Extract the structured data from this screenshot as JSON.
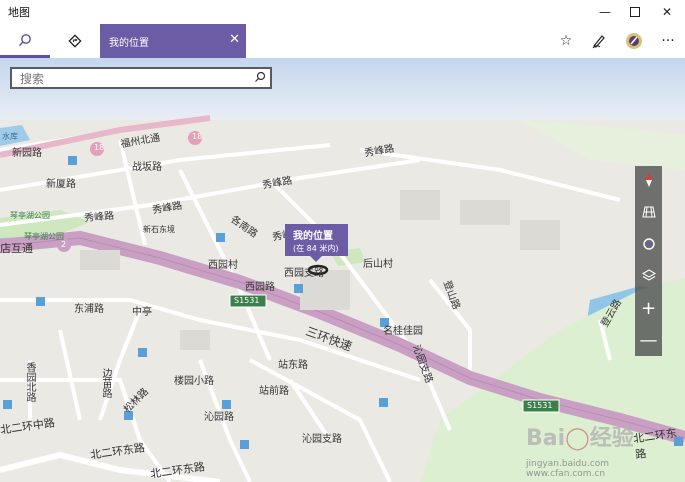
{
  "window": {
    "title": "地图"
  },
  "tabs": {
    "location_label": "我的位置"
  },
  "search": {
    "placeholder": "搜索"
  },
  "marker": {
    "title": "我的位置",
    "accuracy": "(在 84 米内)"
  },
  "map_labels": {
    "shuiku": "水库",
    "fuzhou_beitong": "福州北通",
    "r18a": "18",
    "r18b": "18",
    "xinyuan": "新园路",
    "zhanban": "战坂路",
    "xinxia": "新厦路",
    "xiufeng1": "秀峰路",
    "xiufeng2": "秀峰路",
    "xiufeng3": "秀峰路",
    "xiufeng4": "秀峰路",
    "xiufeng5": "秀峰路",
    "qintinghu": "琴亭湖公园",
    "qintinghu2": "琴亭湖公园",
    "xinshi": "新石东境",
    "gehu": "各南路",
    "xiyuancun": "西园村",
    "xiyuanlu": "西园路",
    "xiyuan2": "西园支路",
    "yincun": "后山村",
    "dianhutong": "店互通",
    "r2": "2",
    "s1531a": "S1531",
    "s1531b": "S1531",
    "dongpu": "东浦路",
    "zhongting": "中亭",
    "sanhuan": "三环快速",
    "mingui": "名桂佳园",
    "dengshan": "登山路",
    "qinyuan": "沁园支路",
    "zhandong": "站东路",
    "zhanqian": "站前路",
    "xiangyuan": "香园北路",
    "biantou": "边苗路",
    "shuimao": "楼园小路",
    "qinyuanlu": "沁园路",
    "qinyuanzhilu": "沁园支路",
    "songlin": "松林路",
    "bei2zhong": "北二环中路",
    "bei2dong": "北二环东路",
    "bei2dong2": "北二环东路",
    "bei2dong3": "北二环东路",
    "qiaokou": "登云路"
  },
  "watermark": {
    "text1": "Bai",
    "text2": "经验",
    "url": "jingyan.baidu.com  www.cfan.com.cn"
  },
  "icons": {
    "search": "search-icon",
    "directions": "directions-icon",
    "close": "close-icon",
    "favorite": "star-icon",
    "ink": "pen-icon",
    "profile": "avatar-icon",
    "more": "more-icon",
    "compass": "compass-icon",
    "tilt": "tilt-icon",
    "mylocation": "locate-icon",
    "layers": "layers-icon",
    "zoomin": "zoom-in-icon",
    "zoomout": "zoom-out-icon"
  },
  "colors": {
    "accent": "#6b5ca5",
    "ring_road": "#c9a0c4",
    "water": "#8fc6e8",
    "green": "#c7e3b0"
  }
}
